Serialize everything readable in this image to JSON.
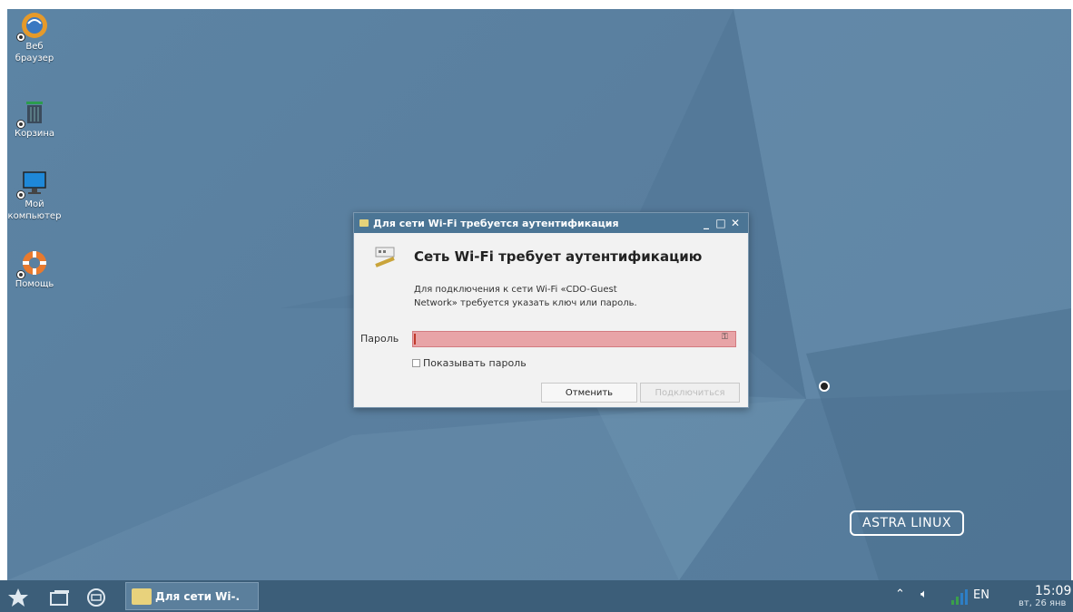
{
  "desktop": {
    "icons": [
      {
        "label_line1": "Веб",
        "label_line2": "браузер",
        "icon": "web-browser-icon"
      },
      {
        "label_line1": "Корзина",
        "label_line2": "",
        "icon": "trash-icon"
      },
      {
        "label_line1": "Мой",
        "label_line2": "компьютер",
        "icon": "computer-icon"
      },
      {
        "label_line1": "Помощь",
        "label_line2": "",
        "icon": "help-icon"
      }
    ],
    "logo_text": "ASTRA LINUX"
  },
  "dialog": {
    "title": "Для сети Wi-Fi требуется аутентификация",
    "heading": "Сеть Wi-Fi требует аутентификацию",
    "description_line1": "Для подключения к сети Wi-Fi «CDO-Guest",
    "description_line2": "Network» требуется указать ключ или пароль.",
    "password_label": "Пароль",
    "password_value": "",
    "show_password_label": "Показывать пароль",
    "show_password_checked": false,
    "cancel_label": "Отменить",
    "connect_label": "Подключиться",
    "controls": {
      "minimize": "_",
      "maximize": "□",
      "close": "✕"
    }
  },
  "taskbar": {
    "task_label": "Для сети Wi-.",
    "tray": {
      "language": "EN",
      "time": "15:09",
      "date": "вт, 26 янв"
    }
  },
  "colors": {
    "desktop": "#5a80a0",
    "titlebar": "#4b7595",
    "taskbar": "#3c5e79",
    "password_error": "#e8a4a7"
  }
}
